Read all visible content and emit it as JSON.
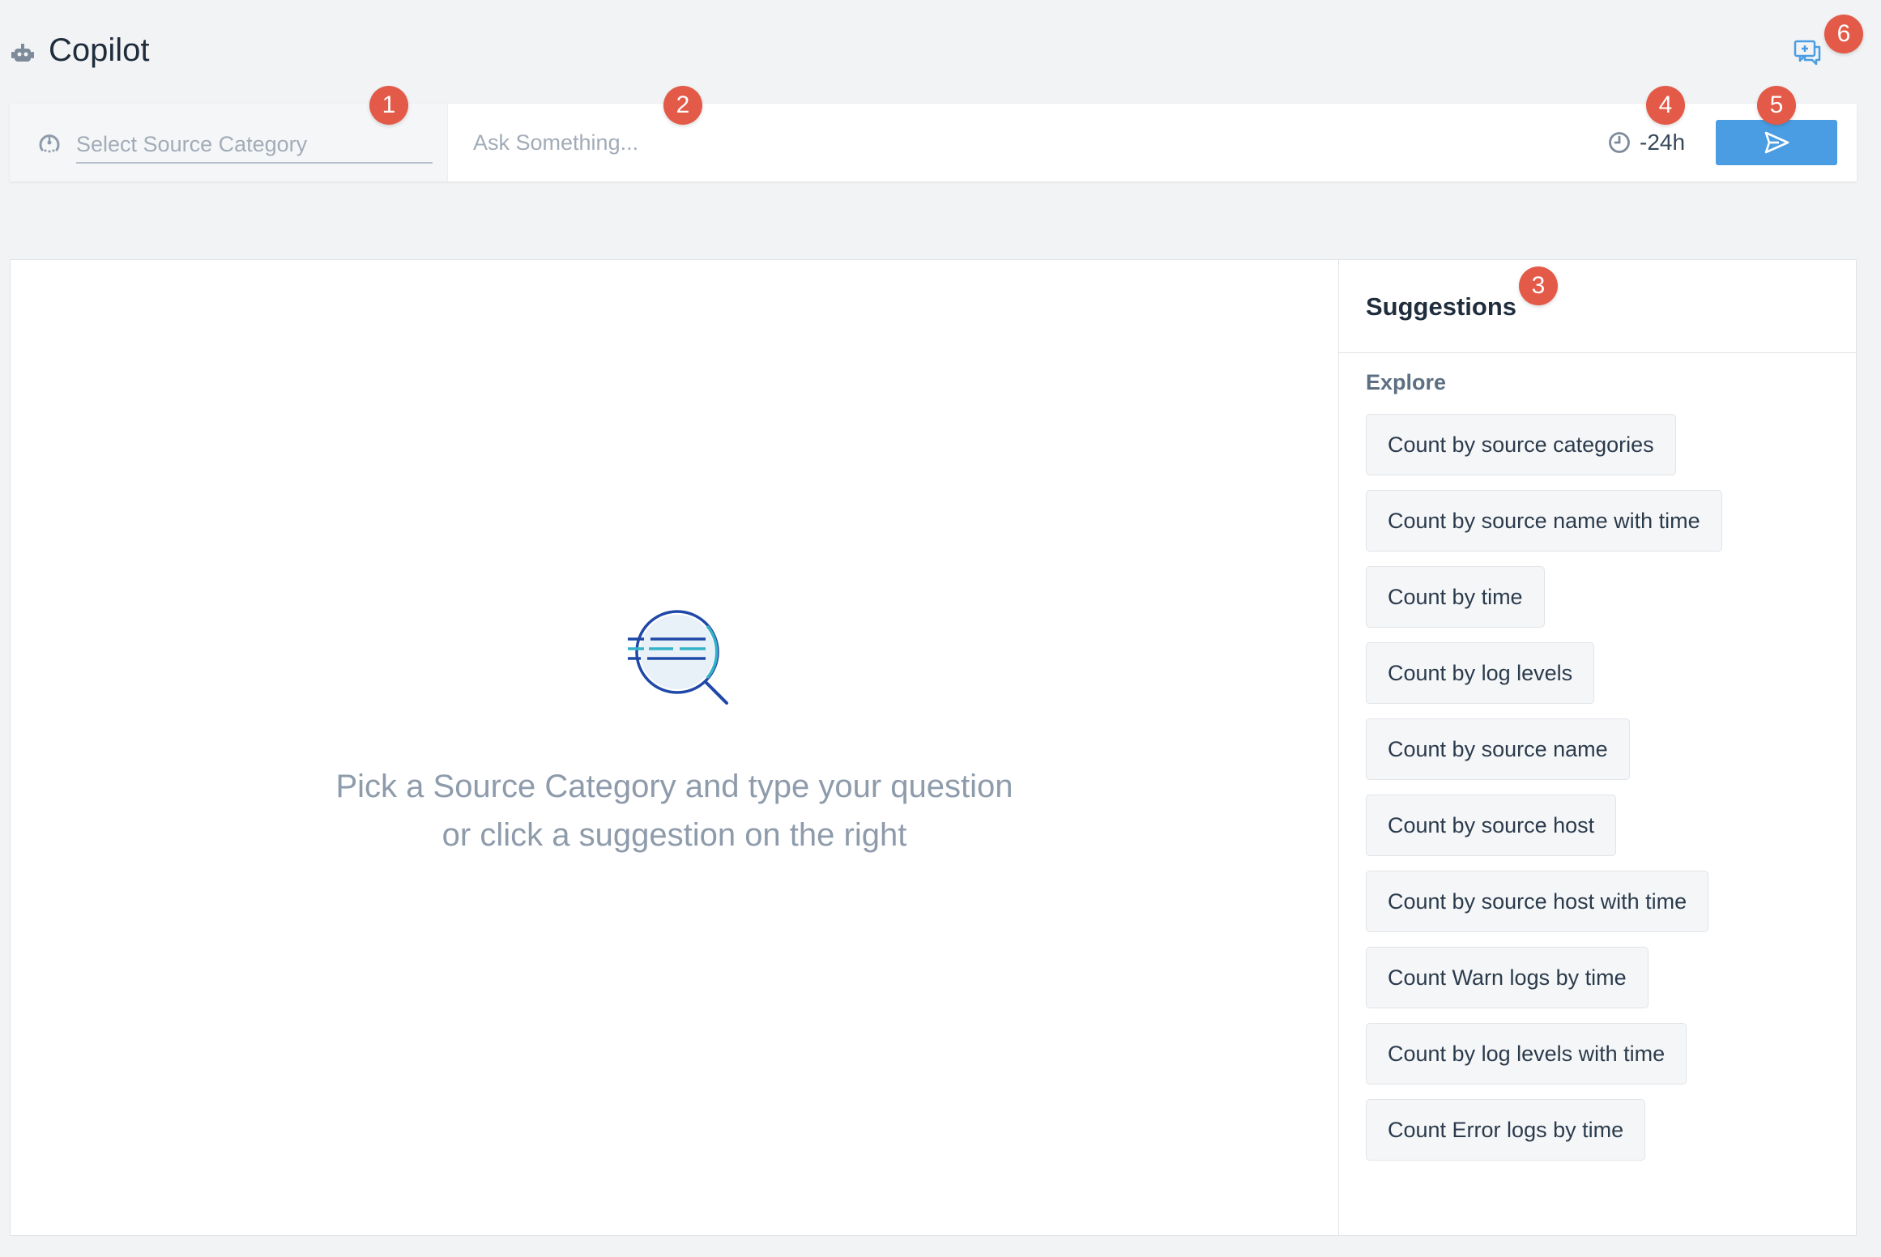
{
  "header": {
    "title": "Copilot",
    "logo_icon": "robot-icon",
    "feedback_icon": "feedback-chat-icon"
  },
  "query_bar": {
    "source_category": {
      "placeholder": "Select Source Category",
      "value": "",
      "icon": "source-category-icon"
    },
    "ask": {
      "placeholder": "Ask Something...",
      "value": ""
    },
    "time_range": {
      "label": "-24h",
      "icon": "clock-icon"
    },
    "send": {
      "icon": "send-icon"
    }
  },
  "empty_state": {
    "line1": "Pick a Source Category and type your question",
    "line2": "or click a suggestion on the right"
  },
  "suggestions": {
    "title": "Suggestions",
    "section": "Explore",
    "items": [
      "Count by source categories",
      "Count by source name with time",
      "Count by time",
      "Count by log levels",
      "Count by source name",
      "Count by source host",
      "Count by source host with time",
      "Count Warn logs by time",
      "Count by log levels with time",
      "Count Error logs by time"
    ]
  },
  "markers": [
    "1",
    "2",
    "3",
    "4",
    "5",
    "6"
  ],
  "colors": {
    "accent": "#4a9de3",
    "marker": "#e35a48",
    "background": "#f2f3f5"
  }
}
